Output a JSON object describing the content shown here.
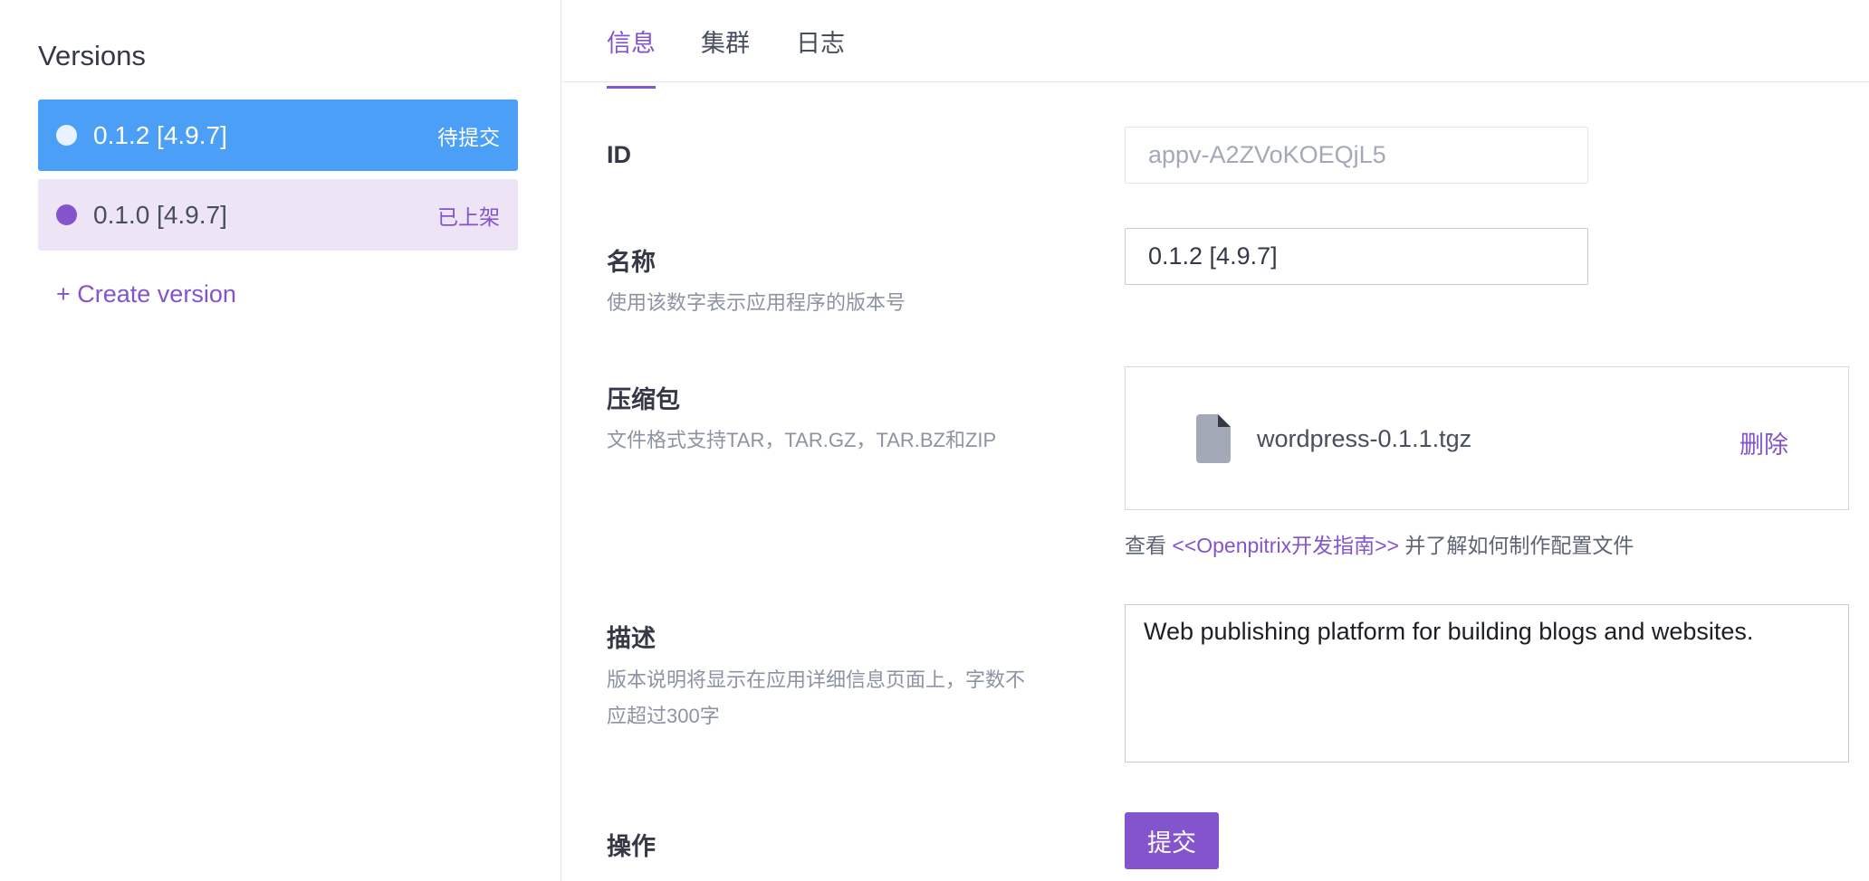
{
  "sidebar": {
    "title": "Versions",
    "versions": [
      {
        "name": "0.1.2 [4.9.7]",
        "status": "待提交"
      },
      {
        "name": "0.1.0 [4.9.7]",
        "status": "已上架"
      }
    ],
    "create_version": "+ Create version"
  },
  "tabs": [
    "信息",
    "集群",
    "日志"
  ],
  "form": {
    "id": {
      "label": "ID",
      "value": "appv-A2ZVoKOEQjL5"
    },
    "name": {
      "label": "名称",
      "hint": "使用该数字表示应用程序的版本号",
      "value": "0.1.2 [4.9.7]"
    },
    "package": {
      "label": "压缩包",
      "hint": "文件格式支持TAR，TAR.GZ，TAR.BZ和ZIP",
      "file_name": "wordpress-0.1.1.tgz",
      "delete": "删除",
      "guide_prefix": "查看",
      "guide_link": "<<Openpitrix开发指南>>",
      "guide_suffix": "并了解如何制作配置文件"
    },
    "description": {
      "label": "描述",
      "hint_line1": "版本说明将显示在应用详细信息页面上，字数不",
      "hint_line2": "应超过300字",
      "value": "Web publishing platform for building blogs and websites."
    },
    "action": {
      "label": "操作",
      "submit": "提交"
    }
  },
  "colors": {
    "accent": "#8454cd",
    "active_blue": "#4b9ff7",
    "muted": "#8c93a2"
  }
}
